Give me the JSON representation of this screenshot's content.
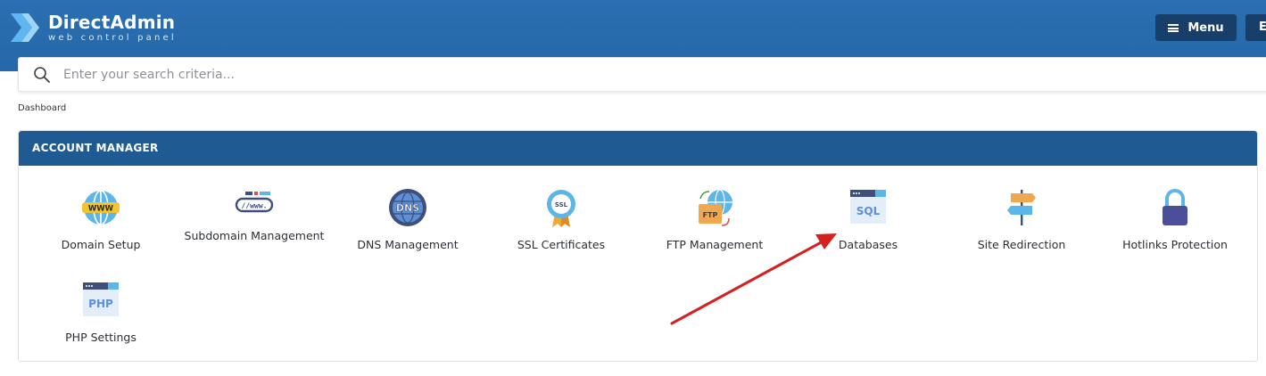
{
  "header": {
    "brand_title": "DirectAdmin",
    "brand_subtitle": "web control panel",
    "menu_label": "Menu",
    "extra_button_label": "E"
  },
  "search": {
    "placeholder": "Enter your search criteria..."
  },
  "breadcrumb": "Dashboard",
  "account_manager": {
    "title": "ACCOUNT MANAGER",
    "items": [
      {
        "label": "Domain Setup",
        "icon": "www-globe-icon"
      },
      {
        "label": "Subdomain Management",
        "icon": "subdomain-url-icon"
      },
      {
        "label": "DNS Management",
        "icon": "dns-globe-icon"
      },
      {
        "label": "SSL Certificates",
        "icon": "ssl-badge-icon"
      },
      {
        "label": "FTP Management",
        "icon": "ftp-sync-icon"
      },
      {
        "label": "Databases",
        "icon": "sql-window-icon"
      },
      {
        "label": "Site Redirection",
        "icon": "signpost-icon"
      },
      {
        "label": "Hotlinks Protection",
        "icon": "padlock-icon"
      },
      {
        "label": "PHP Settings",
        "icon": "php-window-icon"
      }
    ]
  },
  "colors": {
    "header_blue": "#2a6fb2",
    "panel_header": "#1f5a92",
    "button_dark": "#173f69",
    "annotation_arrow": "#d42020"
  }
}
